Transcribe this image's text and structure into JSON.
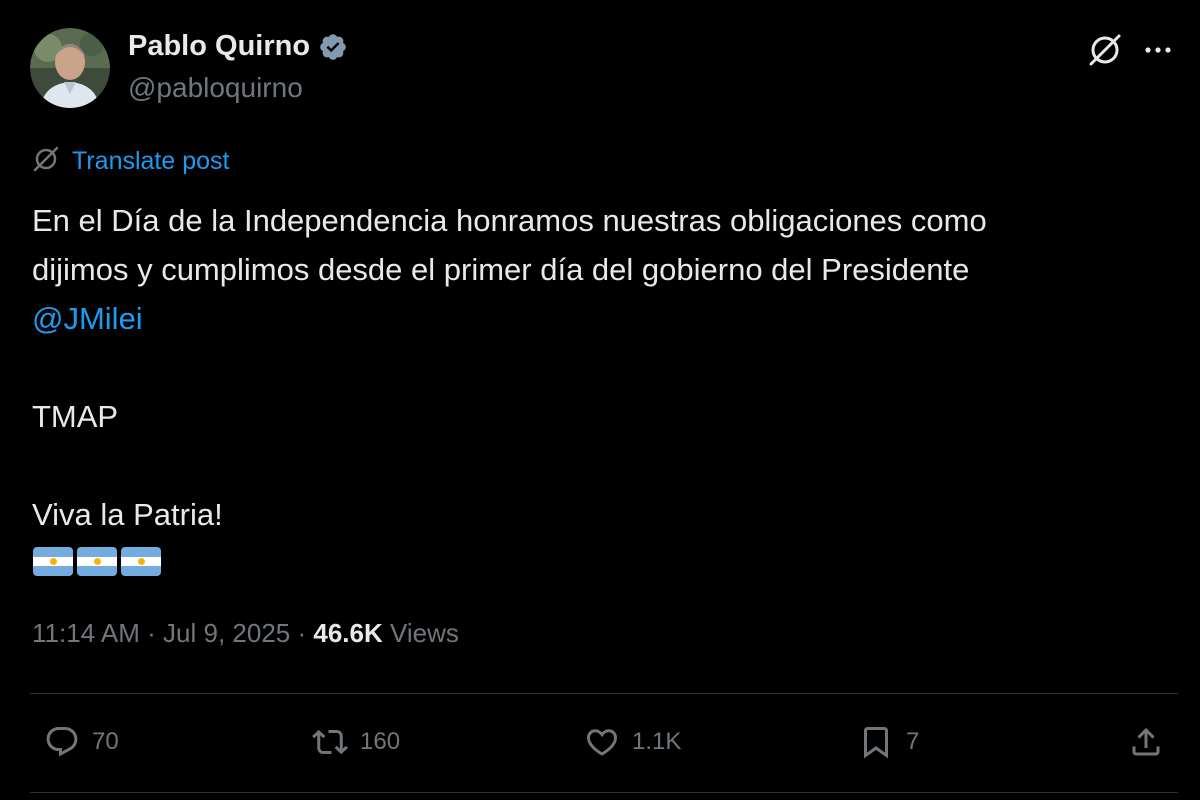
{
  "author": {
    "name": "Pablo Quirno",
    "handle": "@pabloquirno",
    "verified": true,
    "avatar_icon": "avatar"
  },
  "header": {
    "grok_icon": "grok-icon",
    "more_icon": "more-icon"
  },
  "translate": {
    "label": "Translate post",
    "icon": "translate-icon"
  },
  "post": {
    "line1": "En el Día de la Independencia honramos nuestras obligaciones como",
    "line2": "dijimos y cumplimos desde el primer día del gobierno del Presidente",
    "mention": "@JMilei",
    "tmap": "TMAP",
    "closing": "Viva la Patria!",
    "flags": [
      "argentina-flag",
      "argentina-flag",
      "argentina-flag"
    ]
  },
  "meta": {
    "time": "11:14 AM",
    "separator1": " · ",
    "date": "Jul 9, 2025",
    "separator2": " · ",
    "views_count": "46.6K",
    "views_label": " Views"
  },
  "actions": {
    "replies": "70",
    "reposts": "160",
    "likes": "1.1K",
    "bookmarks": "7"
  },
  "colors": {
    "background": "#000000",
    "text": "#e7e9ea",
    "muted": "#71767b",
    "link": "#1d9bf0",
    "verified": "#829aab",
    "divider": "#2f3336"
  }
}
